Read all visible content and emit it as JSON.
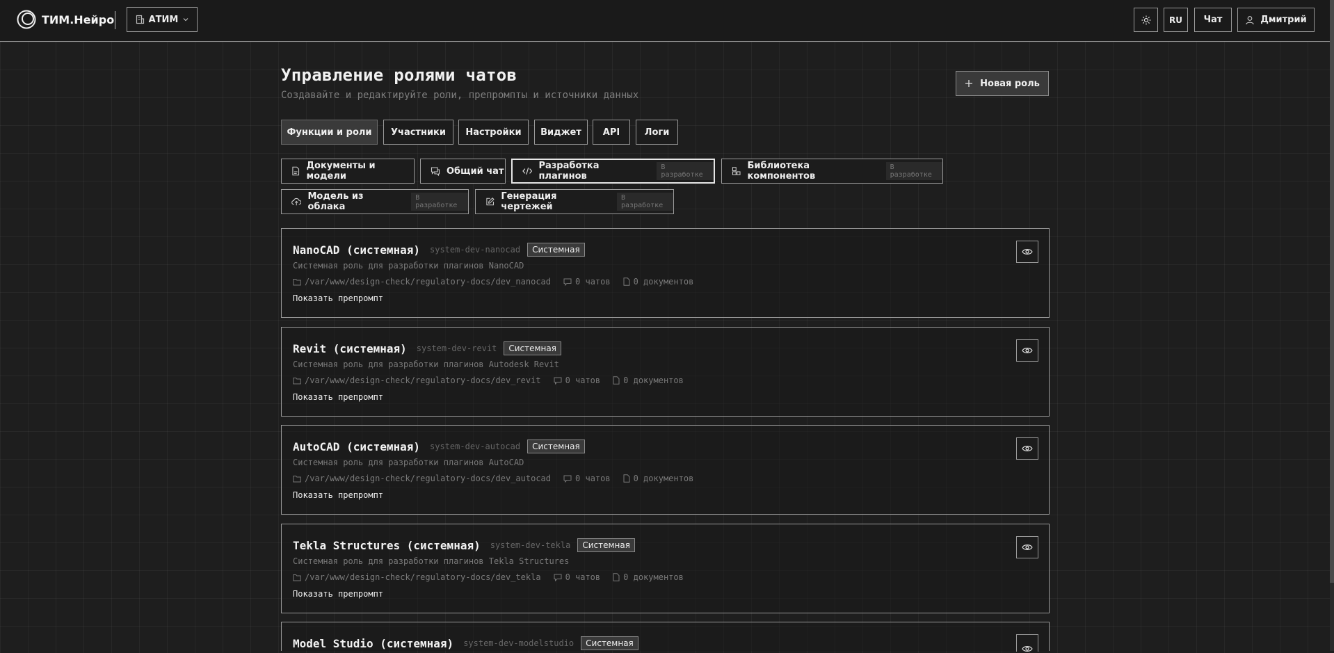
{
  "header": {
    "logo_text": "ТИМ.Нейро",
    "org": "АТИМ",
    "lang": "RU",
    "chat": "Чат",
    "user": "Дмитрий"
  },
  "page": {
    "title": "Управление ролями чатов",
    "subtitle": "Создавайте и редактируйте роли, препромпты и источники данных",
    "new_role": "Новая роль"
  },
  "tabs": [
    {
      "label": "Функции и роли",
      "active": true
    },
    {
      "label": "Участники"
    },
    {
      "label": "Настройки"
    },
    {
      "label": "Виджет"
    },
    {
      "label": "API"
    },
    {
      "label": "Логи"
    }
  ],
  "functions": [
    {
      "label": "Документы и модели",
      "icon": "document-icon"
    },
    {
      "label": "Общий чат",
      "icon": "chat-icon"
    },
    {
      "label": "Разработка плагинов",
      "icon": "code-icon",
      "badge": "В разработке",
      "active": true
    },
    {
      "label": "Библиотека компонентов",
      "icon": "components-icon",
      "badge": "В разработке"
    },
    {
      "label": "Модель из облака",
      "icon": "cloud-upload-icon",
      "badge": "В разработке"
    },
    {
      "label": "Генерация чертежей",
      "icon": "edit-icon",
      "badge": "В разработке"
    }
  ],
  "roles": [
    {
      "name": "NanoCAD (системная)",
      "slug": "system-dev-nanocad",
      "badge": "Системная",
      "description": "Системная роль для разработки плагинов NanoCAD",
      "path": "/var/www/design-check/regulatory-docs/dev_nanocad",
      "chats": "0 чатов",
      "docs": "0 документов",
      "show_prompt": "Показать препромпт"
    },
    {
      "name": "Revit (системная)",
      "slug": "system-dev-revit",
      "badge": "Системная",
      "description": "Системная роль для разработки плагинов Autodesk Revit",
      "path": "/var/www/design-check/regulatory-docs/dev_revit",
      "chats": "0 чатов",
      "docs": "0 документов",
      "show_prompt": "Показать препромпт"
    },
    {
      "name": "AutoCAD (системная)",
      "slug": "system-dev-autocad",
      "badge": "Системная",
      "description": "Системная роль для разработки плагинов AutoCAD",
      "path": "/var/www/design-check/regulatory-docs/dev_autocad",
      "chats": "0 чатов",
      "docs": "0 документов",
      "show_prompt": "Показать препромпт"
    },
    {
      "name": "Tekla Structures (системная)",
      "slug": "system-dev-tekla",
      "badge": "Системная",
      "description": "Системная роль для разработки плагинов Tekla Structures",
      "path": "/var/www/design-check/regulatory-docs/dev_tekla",
      "chats": "0 чатов",
      "docs": "0 документов",
      "show_prompt": "Показать препромпт"
    },
    {
      "name": "Model Studio (системная)",
      "slug": "system-dev-modelstudio",
      "badge": "Системная"
    }
  ]
}
